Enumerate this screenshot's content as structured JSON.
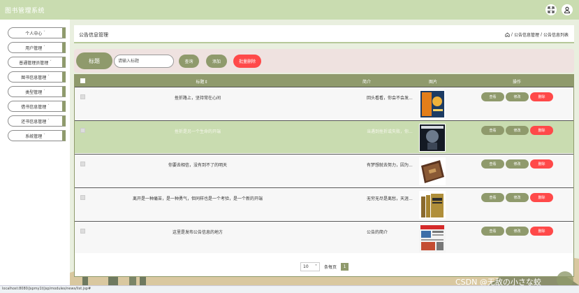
{
  "app": {
    "title": "图书管理系统"
  },
  "topbar": {
    "fullscreen_icon": "expand-icon",
    "user_icon": "user-icon"
  },
  "sidebar": {
    "items": [
      {
        "label": "个人中心"
      },
      {
        "label": "用户管理"
      },
      {
        "label": "普通管理员管理"
      },
      {
        "label": "图书信息管理"
      },
      {
        "label": "类型管理"
      },
      {
        "label": "借书信息管理"
      },
      {
        "label": "还书信息管理"
      },
      {
        "label": "系统管理"
      }
    ],
    "chevron": "˅"
  },
  "header": {
    "title": "公告信息管理",
    "breadcrumb": [
      "公告信息管理",
      "公告信息列表"
    ],
    "separator": "/"
  },
  "search": {
    "label": "标题",
    "placeholder": "请输入标题",
    "query_btn": "查询",
    "add_btn": "添加",
    "batch_delete_btn": "批量删除"
  },
  "table": {
    "columns": [
      "标题",
      "简介",
      "图片",
      "操作"
    ],
    "sort_mark": "⇕",
    "rows": [
      {
        "title": "挫折路上，坚持常在心间",
        "brief": "回头看看，你会不会发...",
        "image": "book-cover-orange"
      },
      {
        "title": "挫折是另一个生命的开端",
        "brief": "当遇到挫折或失败，你...",
        "image": "book-cover-dark"
      },
      {
        "title": "你要去相信，没有到不了的明天",
        "brief": "有梦想就去努力，因为...",
        "image": "book-cover-brown"
      },
      {
        "title": "离开是一种痛苦，是一种勇气，但同样也是一个考验，是一个新的开端",
        "brief": "无穷无尽是离愁，天涯...",
        "image": "book-set"
      },
      {
        "title": "这里是发布公告信息的地方",
        "brief": "公告的简介",
        "image": "newspaper"
      }
    ],
    "actions": {
      "view": "查看",
      "edit": "修改",
      "delete": "删除"
    },
    "highlighted_row": 1
  },
  "pager": {
    "page_size": "10",
    "per_page_label": "条每页",
    "current_page": "1"
  },
  "status": {
    "url": "localhost:8080/jspmy1t/jsp/modules/news/list.jsp#"
  },
  "watermark": "CSDN @无敌の小さな蛟",
  "colors": {
    "accent": "#8f9a6c",
    "danger": "#ff4949",
    "topbar": "#c9dcb0",
    "highlight": "#c9dcb0"
  }
}
